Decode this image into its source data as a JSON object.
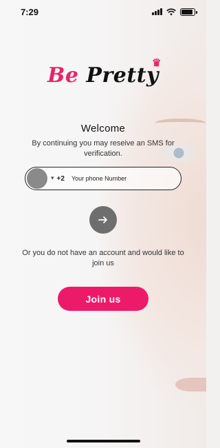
{
  "status_bar": {
    "time": "7:29",
    "signal_icon": "cellular-signal-icon",
    "wifi_icon": "wifi-icon",
    "battery_icon": "battery-icon",
    "battery_level": 0.9
  },
  "logo": {
    "part1": "Be",
    "part2": "Pretty",
    "crown_icon": "crown-icon",
    "brand_color": "#e8246a"
  },
  "welcome": {
    "title": "Welcome",
    "subtitle": "By continuing you may reseive an SMS for verification."
  },
  "phone": {
    "flag_icon": "country-flag-icon",
    "caret": "▾",
    "dial_code": "+2",
    "placeholder": "Your phone Number",
    "value": ""
  },
  "next_button": {
    "icon": "arrow-right-icon",
    "color": "#6e6e6e"
  },
  "join": {
    "prompt": "Or you do not have an account and would like to join us",
    "button_label": "Join us",
    "button_color": "#ed1a6a"
  }
}
